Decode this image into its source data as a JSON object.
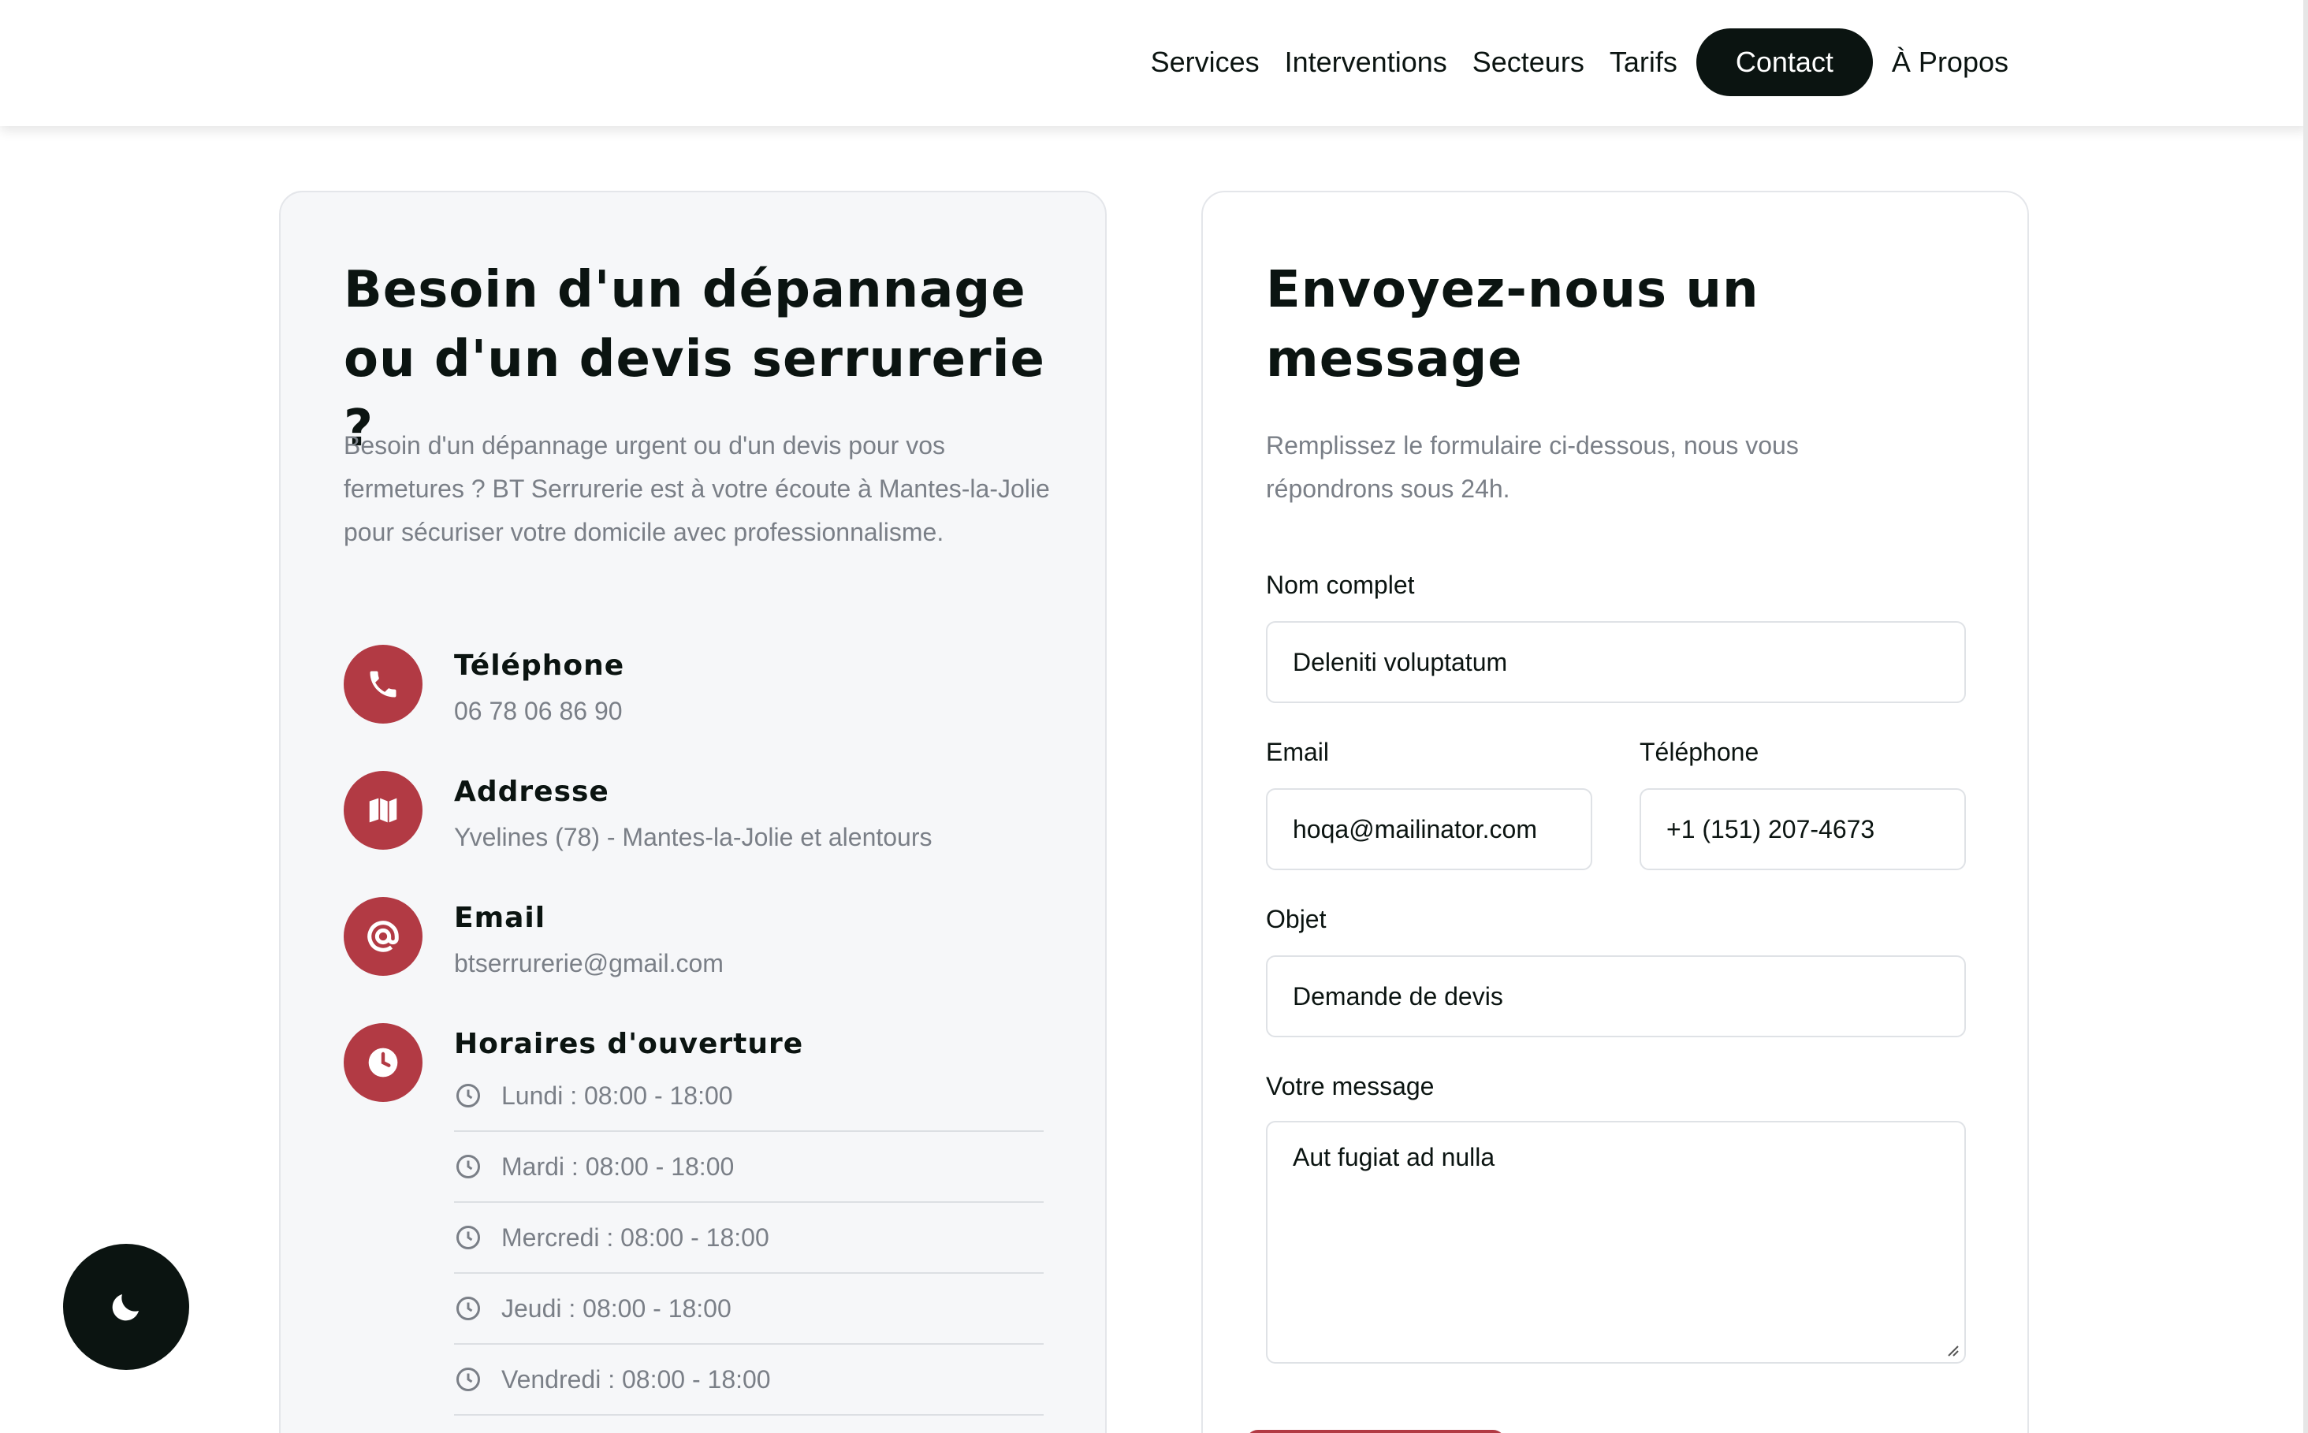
{
  "nav": {
    "items": [
      "Services",
      "Interventions",
      "Secteurs",
      "Tarifs"
    ],
    "contact": "Contact",
    "about": "À Propos"
  },
  "info": {
    "heading": "Besoin d'un dépannage ou d'un devis serrurerie ?",
    "intro": "Besoin d'un dépannage urgent ou d'un devis pour vos fermetures ? BT Serrurerie est à votre écoute à Mantes-la-Jolie pour sécuriser votre domicile avec professionnalisme.",
    "phone": {
      "title": "Téléphone",
      "value": "06 78 06 86 90",
      "icon": "phone-icon"
    },
    "address": {
      "title": "Addresse",
      "value": "Yvelines (78) - Mantes-la-Jolie et alentours",
      "icon": "map-icon"
    },
    "email": {
      "title": "Email",
      "value": "btserrurerie@gmail.com",
      "icon": "at-icon"
    },
    "hours": {
      "title": "Horaires d'ouverture",
      "icon": "clock-icon",
      "days": [
        "Lundi : 08:00 - 18:00",
        "Mardi : 08:00 - 18:00",
        "Mercredi : 08:00 - 18:00",
        "Jeudi : 08:00 - 18:00",
        "Vendredi : 08:00 - 18:00"
      ]
    }
  },
  "form": {
    "heading": "Envoyez-nous un message",
    "intro": "Remplissez le formulaire ci-dessous, nous vous répondrons sous 24h.",
    "name_label": "Nom complet",
    "name_value": "Deleniti voluptatum",
    "email_label": "Email",
    "email_value": "hoqa@mailinator.com",
    "phone_label": "Téléphone",
    "phone_value": "+1 (151) 207-4673",
    "subject_label": "Objet",
    "subject_value": "Demande de devis",
    "message_label": "Votre message",
    "message_value": "Aut fugiat ad nulla"
  },
  "theme_toggle": {
    "icon": "moon-icon"
  },
  "colors": {
    "accent": "#b23a44",
    "dark": "#0b1411",
    "muted": "#7a7f87"
  }
}
